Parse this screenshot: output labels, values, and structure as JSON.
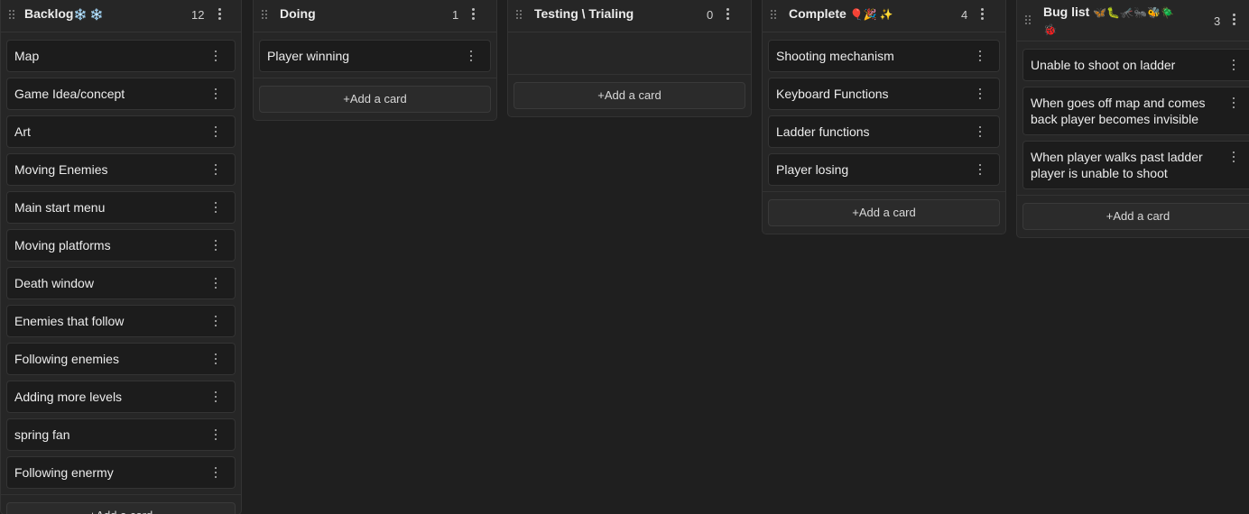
{
  "columns": [
    {
      "title": "Backlog",
      "emoji": "❄️ ❄️",
      "count": "12",
      "cards": [
        "Map",
        "Game Idea/concept",
        "Art",
        "Moving Enemies",
        "Main start menu",
        "Moving platforms",
        "Death window",
        "Enemies that follow",
        "Following enemies",
        "Adding more levels",
        "spring fan",
        "Following enermy"
      ],
      "add_label": "+Add a card"
    },
    {
      "title": "Doing",
      "emoji": "",
      "count": "1",
      "cards": [
        "Player winning"
      ],
      "add_label": "+Add a card"
    },
    {
      "title": "Testing \\ Trialing",
      "emoji": "",
      "count": "0",
      "cards": [],
      "add_label": "+Add a card"
    },
    {
      "title": "Complete",
      "emoji": "🎈🎉 ✨",
      "count": "4",
      "cards": [
        "Shooting mechanism",
        "Keyboard Functions",
        "Ladder functions",
        "Player losing"
      ],
      "add_label": "+Add a card"
    },
    {
      "title": "Bug list",
      "emoji": "🦋🐛🦟🐜🐝🪲 🐞",
      "count": "3",
      "cards": [
        "Unable to shoot on ladder",
        "When goes off map and comes back player becomes invisible",
        "When player walks past ladder player is unable to shoot"
      ],
      "add_label": "+Add a card"
    }
  ]
}
